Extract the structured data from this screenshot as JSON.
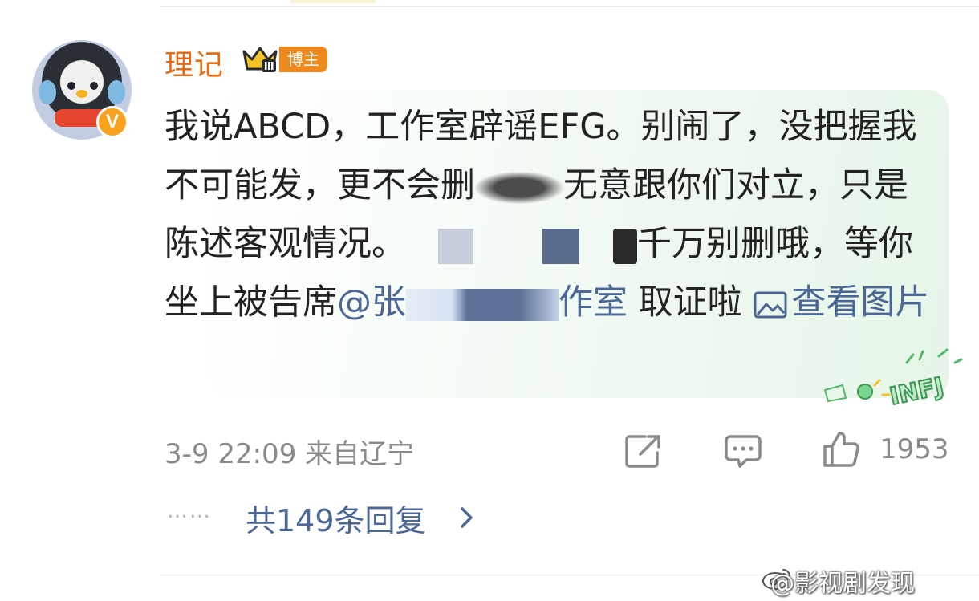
{
  "comment": {
    "username": "理记",
    "badge_label": "博主",
    "verified_mark": "V",
    "text_part1": "我说ABCD，工作室辟谣EFG。别闹了，没把握我不可能发，更不会删",
    "text_part2": "无意跟你们对立，只是陈述客观情况。",
    "text_part3": "千万别删哦，等你坐上被告席",
    "mention": "@张",
    "mention_tail": "作室",
    "text_part4": " 取证啦 ",
    "view_pictures": "查看图片",
    "sticker_text": "INFJ"
  },
  "meta": {
    "date_time": "3-9 22:09",
    "location": "来自辽宁",
    "like_count": "1953"
  },
  "replies": {
    "dots": "……",
    "label": "共149条回复"
  },
  "watermark": {
    "text": "@影视剧发现"
  },
  "icons": {
    "share": "share-icon",
    "comment": "comment-icon",
    "like": "thumbs-up-icon",
    "crown": "crown-icon"
  },
  "colors": {
    "username": "#e86a10",
    "badge": "#ee8a1d",
    "link": "#4a6796",
    "meta": "#8a8a8a"
  }
}
